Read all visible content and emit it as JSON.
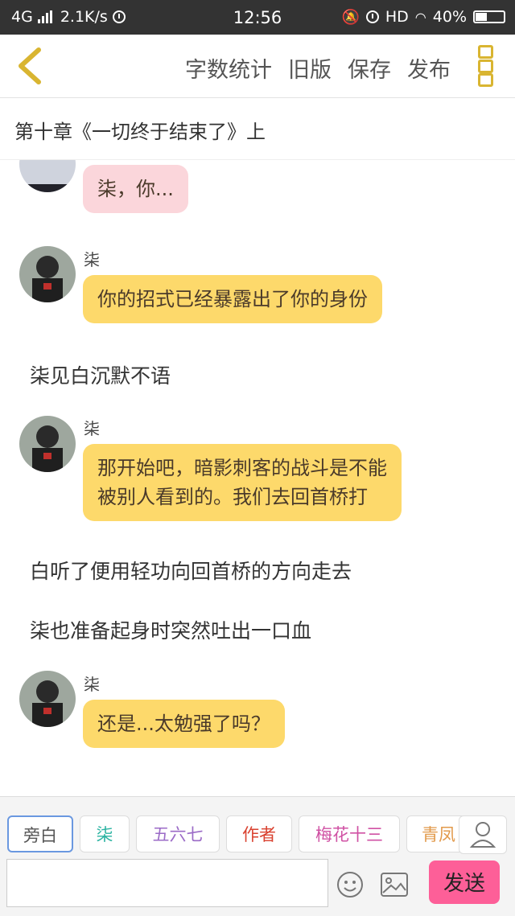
{
  "status": {
    "network": "4G",
    "speed": "2.1K/s",
    "time": "12:56",
    "hd": "HD",
    "battery": "40%"
  },
  "topbar": {
    "word_count": "字数统计",
    "old_version": "旧版",
    "save": "保存",
    "publish": "发布"
  },
  "chapter_title": "第十章《一切终于结束了》上",
  "messages": {
    "m1": {
      "text": "柒，你..."
    },
    "m2": {
      "name": "柒",
      "text": "你的招式已经暴露出了你的身份"
    },
    "n1": {
      "text": "柒见白沉默不语"
    },
    "m3": {
      "name": "柒",
      "line1": "那开始吧，暗影刺客的战斗是不能",
      "line2": "被别人看到的。我们去回首桥打"
    },
    "n2": {
      "text": "白听了便用轻功向回首桥的方向走去"
    },
    "n3": {
      "text": "柒也准备起身时突然吐出一口血"
    },
    "m4": {
      "name": "柒",
      "text": "还是...太勉强了吗？"
    }
  },
  "tags": [
    {
      "label": "旁白",
      "color": "#555555"
    },
    {
      "label": "柒",
      "color": "#2bb3a2"
    },
    {
      "label": "五六七",
      "color": "#9b6bc7"
    },
    {
      "label": "作者",
      "color": "#d9412f"
    },
    {
      "label": "梅花十三",
      "color": "#d052a4"
    },
    {
      "label": "青凤",
      "color": "#e2994a"
    }
  ],
  "send_label": "发送"
}
